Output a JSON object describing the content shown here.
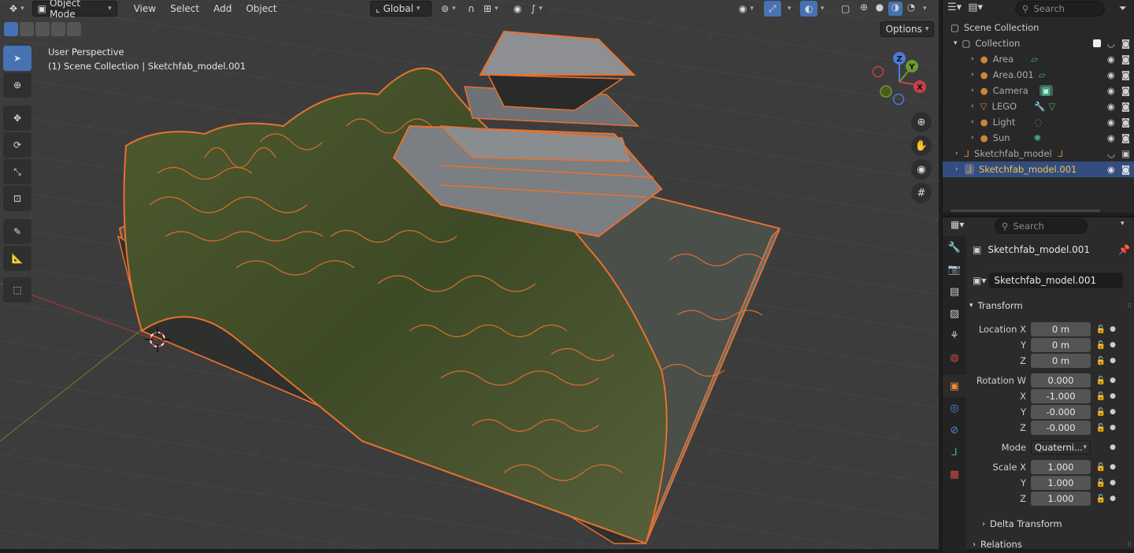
{
  "header": {
    "mode": "Object Mode",
    "menus": [
      "View",
      "Select",
      "Add",
      "Object"
    ],
    "transform_orientation": "Global",
    "options_label": "Options"
  },
  "viewport": {
    "perspective_label": "User Perspective",
    "context_label": "(1) Scene Collection | Sketchfab_model.001",
    "gizmo_axes": [
      "Z",
      "Y",
      "X"
    ]
  },
  "outliner": {
    "search_placeholder": "Search",
    "root": "Scene Collection",
    "collection": "Collection",
    "items": [
      {
        "label": "Area",
        "icon": "light-icon"
      },
      {
        "label": "Area.001",
        "icon": "light-icon"
      },
      {
        "label": "Camera",
        "icon": "camera-icon"
      },
      {
        "label": "LEGO",
        "icon": "mesh-icon"
      },
      {
        "label": "Light",
        "icon": "light-icon"
      },
      {
        "label": "Sun",
        "icon": "sun-icon"
      }
    ],
    "model": "Sketchfab_model",
    "selected": "Sketchfab_model.001"
  },
  "properties": {
    "search_placeholder": "Search",
    "object_name": "Sketchfab_model.001",
    "object_field": "Sketchfab_model.001",
    "transform_title": "Transform",
    "location": {
      "label": "Location X",
      "x": "0 m",
      "y": "0 m",
      "z": "0 m"
    },
    "rotation": {
      "label": "Rotation W",
      "w": "0.000",
      "x": "-1.000",
      "y": "-0.000",
      "z": "-0.000"
    },
    "axis_labels": {
      "x": "X",
      "y": "Y",
      "z": "Z"
    },
    "mode_label": "Mode",
    "mode_value": "Quaterni...",
    "scale": {
      "label": "Scale X",
      "x": "1.000",
      "y": "1.000",
      "z": "1.000"
    },
    "delta_transform": "Delta Transform",
    "relations": "Relations"
  },
  "colors": {
    "accent": "#4772b3",
    "selection_outline": "#e8712f",
    "selected_text": "#f5c24a"
  }
}
